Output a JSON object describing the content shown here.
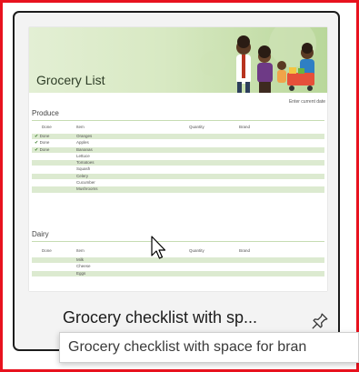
{
  "template": {
    "caption": "Grocery checklist with sp...",
    "tooltip": "Grocery checklist with space for bran",
    "pin_icon": "pin-icon"
  },
  "preview": {
    "banner_title": "Grocery List",
    "current_date_placeholder": "Enter current date",
    "sections": [
      {
        "heading": "Produce",
        "columns": [
          "Done",
          "Item",
          "Quantity",
          "Brand"
        ],
        "rows": [
          {
            "done": "Done",
            "checked": true,
            "item": "Oranges"
          },
          {
            "done": "Done",
            "checked": true,
            "item": "Apples"
          },
          {
            "done": "Done",
            "checked": true,
            "item": "Bananas"
          },
          {
            "done": "",
            "checked": false,
            "item": "Lettuce"
          },
          {
            "done": "",
            "checked": false,
            "item": "Tomatoes"
          },
          {
            "done": "",
            "checked": false,
            "item": "Squash"
          },
          {
            "done": "",
            "checked": false,
            "item": "Celery"
          },
          {
            "done": "",
            "checked": false,
            "item": "Cucumber"
          },
          {
            "done": "",
            "checked": false,
            "item": "Mushrooms"
          }
        ]
      },
      {
        "heading": "Dairy",
        "columns": [
          "Done",
          "Item",
          "Quantity",
          "Brand"
        ],
        "rows": [
          {
            "done": "",
            "checked": false,
            "item": "Milk"
          },
          {
            "done": "",
            "checked": false,
            "item": "Cheese"
          },
          {
            "done": "",
            "checked": false,
            "item": "Eggs"
          }
        ]
      }
    ]
  },
  "colors": {
    "highlight_border": "#e8121e",
    "row_tint": "#dcead0",
    "banner_green": "#b9d79a"
  }
}
